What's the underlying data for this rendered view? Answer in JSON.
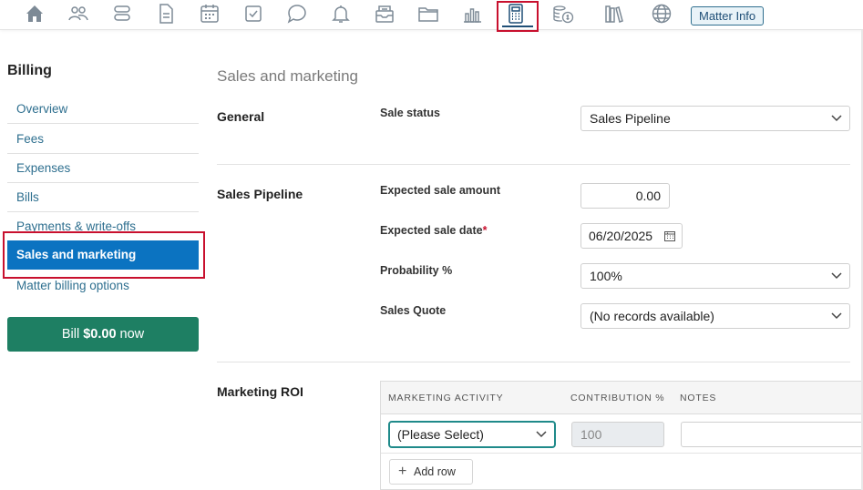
{
  "toolbar": {
    "icons": [
      "home-icon",
      "contacts-icon",
      "matters-icon",
      "documents-icon",
      "calendar-icon",
      "tasks-icon",
      "communications-icon",
      "notifications-icon",
      "inbox-icon",
      "folder-icon",
      "reports-icon",
      "billing-calculator-icon",
      "accounts-coins-icon",
      "library-icon",
      "web-icon"
    ],
    "active_icon": "billing-calculator-icon",
    "matter_info_label": "Matter Info"
  },
  "sidebar": {
    "title": "Billing",
    "items": [
      {
        "label": "Overview"
      },
      {
        "label": "Fees"
      },
      {
        "label": "Expenses"
      },
      {
        "label": "Bills"
      },
      {
        "label": "Payments & write-offs"
      },
      {
        "label": "Sales and marketing",
        "active": true
      },
      {
        "label": "Matter billing options"
      }
    ],
    "bill_button": {
      "prefix": "Bill",
      "amount": "$0.00",
      "suffix": "now"
    }
  },
  "main": {
    "page_title": "Sales and marketing",
    "general": {
      "heading": "General",
      "sale_status_label": "Sale status",
      "sale_status_value": "Sales Pipeline"
    },
    "pipeline": {
      "heading": "Sales Pipeline",
      "expected_amount_label": "Expected sale amount",
      "expected_amount_value": "0.00",
      "expected_date_label": "Expected sale date",
      "required_mark": "*",
      "expected_date_value": "06/20/2025",
      "probability_label": "Probability %",
      "probability_value": "100%",
      "quote_label": "Sales Quote",
      "quote_value": "(No records available)"
    },
    "roi": {
      "heading": "Marketing ROI",
      "columns": [
        "MARKETING ACTIVITY",
        "CONTRIBUTION %",
        "NOTES"
      ],
      "row": {
        "activity": "(Please Select)",
        "contribution_placeholder": "100",
        "notes": ""
      },
      "add_row_label": "Add row"
    }
  },
  "colors": {
    "active_highlight": "#c8102e",
    "sidebar_active": "#0b73c1",
    "bill_button": "#1e7f63",
    "link": "#2e6f8f"
  }
}
